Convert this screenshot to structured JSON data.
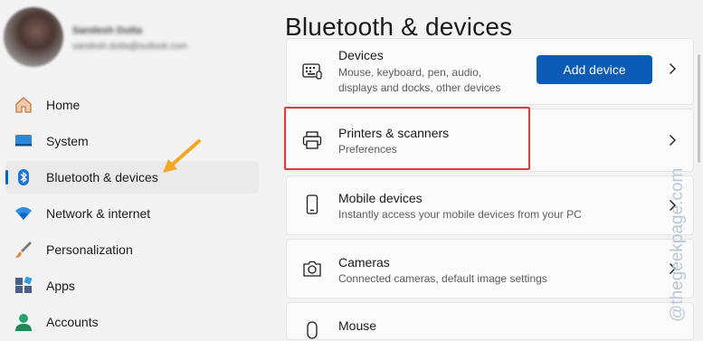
{
  "user": {
    "name": "Sandesh Dutta",
    "email": "sandesh.dutta@outlook.com"
  },
  "sidebar": {
    "items": [
      {
        "label": "Home",
        "icon": "home-icon"
      },
      {
        "label": "System",
        "icon": "system-icon"
      },
      {
        "label": "Bluetooth & devices",
        "icon": "bluetooth-icon",
        "selected": true
      },
      {
        "label": "Network & internet",
        "icon": "wifi-icon"
      },
      {
        "label": "Personalization",
        "icon": "brush-icon"
      },
      {
        "label": "Apps",
        "icon": "apps-icon"
      },
      {
        "label": "Accounts",
        "icon": "accounts-icon"
      }
    ]
  },
  "main": {
    "title": "Bluetooth & devices",
    "cards": [
      {
        "title": "Devices",
        "subtitle": "Mouse, keyboard, pen, audio, displays and docks, other devices",
        "button": "Add device",
        "icon": "keyboard-icon"
      },
      {
        "title": "Printers & scanners",
        "subtitle": "Preferences",
        "icon": "printer-icon"
      },
      {
        "title": "Mobile devices",
        "subtitle": "Instantly access your mobile devices from your PC",
        "icon": "phone-icon"
      },
      {
        "title": "Cameras",
        "subtitle": "Connected cameras, default image settings",
        "icon": "camera-icon"
      },
      {
        "title": "Mouse",
        "subtitle": "",
        "icon": "mouse-icon"
      }
    ]
  },
  "watermark": "@thegeekpage.com",
  "colors": {
    "accent": "#0067c0",
    "button": "#0a5cb4",
    "highlight": "#e23b3b",
    "arrow": "#f5a623"
  }
}
